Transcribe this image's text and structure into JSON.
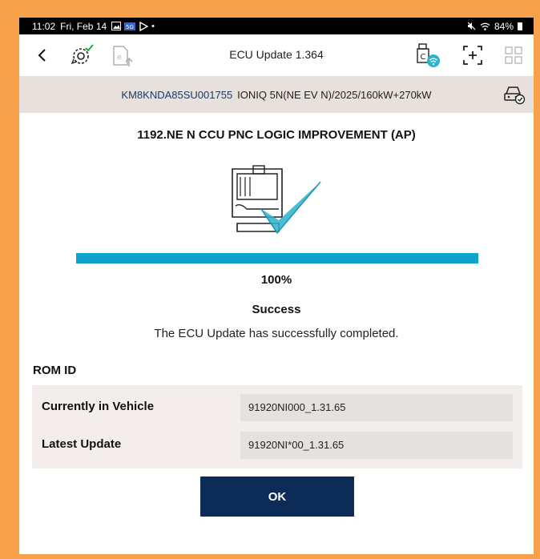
{
  "status_bar": {
    "time": "11:02",
    "date": "Fri, Feb 14",
    "extra": "•",
    "battery": "84%"
  },
  "app_bar": {
    "title": "ECU Update 1.364"
  },
  "vehicle": {
    "vin": "KM8KNDA85SU001755",
    "model": "IONIQ 5N(NE EV N)/2025/160kW+270kW"
  },
  "update": {
    "heading": "1192.NE N CCU PNC LOGIC IMPROVEMENT (AP)",
    "progress_percent": 100,
    "progress_label": "100%",
    "result_title": "Success",
    "result_message": "The ECU Update has successfully completed."
  },
  "rom": {
    "section_label": "ROM ID",
    "rows": [
      {
        "label": "Currently in Vehicle",
        "value": "91920NI000_1.31.65"
      },
      {
        "label": "Latest Update",
        "value": "91920NI*00_1.31.65"
      }
    ]
  },
  "actions": {
    "ok_label": "OK"
  },
  "colors": {
    "frame_border": "#f7a14a",
    "progress": "#0ea4c9",
    "button": "#0d2b57",
    "vin_text": "#1b3a6b",
    "check_accent": "#2bb3d0"
  },
  "icons": [
    "back-arrow-icon",
    "gear-check-icon",
    "file-upload-icon",
    "ecu-wifi-icon",
    "add-bracket-icon",
    "grid-icon",
    "car-check-icon",
    "ecu-success-illustration"
  ]
}
